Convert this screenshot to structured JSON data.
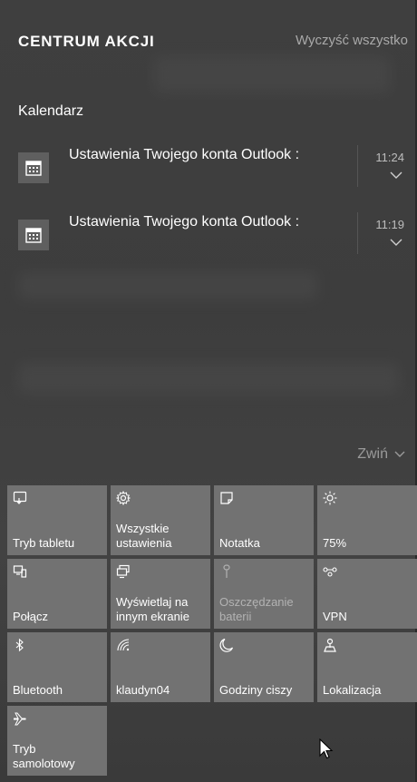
{
  "header": {
    "title": "CENTRUM AKCJI",
    "clear_all": "Wyczyść wszystko"
  },
  "group": {
    "title": "Kalendarz"
  },
  "notifications": [
    {
      "text": "Ustawienia Twojego konta Outlook :",
      "time": "11:24",
      "icon": "calendar-icon"
    },
    {
      "text": "Ustawienia Twojego konta Outlook :",
      "time": "11:19",
      "icon": "calendar-icon"
    }
  ],
  "collapse_label": "Zwiń",
  "quick_actions": [
    {
      "label": "Tryb tabletu",
      "icon": "tablet-mode-icon"
    },
    {
      "label": "Wszystkie\nustawienia",
      "icon": "gear-icon"
    },
    {
      "label": "Notatka",
      "icon": "note-icon"
    },
    {
      "label": "75%",
      "icon": "brightness-icon"
    },
    {
      "label": "Połącz",
      "icon": "connect-icon"
    },
    {
      "label": "Wyświetlaj na\ninnym ekranie",
      "icon": "project-icon"
    },
    {
      "label": "Oszczędzanie\nbaterii",
      "icon": "battery-saver-icon",
      "disabled": true
    },
    {
      "label": "VPN",
      "icon": "vpn-icon"
    },
    {
      "label": "Bluetooth",
      "icon": "bluetooth-icon"
    },
    {
      "label": "klaudyn04",
      "icon": "wifi-icon"
    },
    {
      "label": "Godziny ciszy",
      "icon": "moon-icon"
    },
    {
      "label": "Lokalizacja",
      "icon": "location-icon"
    },
    {
      "label": "Tryb\nsamolotowy",
      "icon": "airplane-icon"
    }
  ],
  "colors": {
    "tile_bg": "#727272",
    "panel_bg": "#3f3f3f",
    "muted_text": "#a9a9a9"
  }
}
